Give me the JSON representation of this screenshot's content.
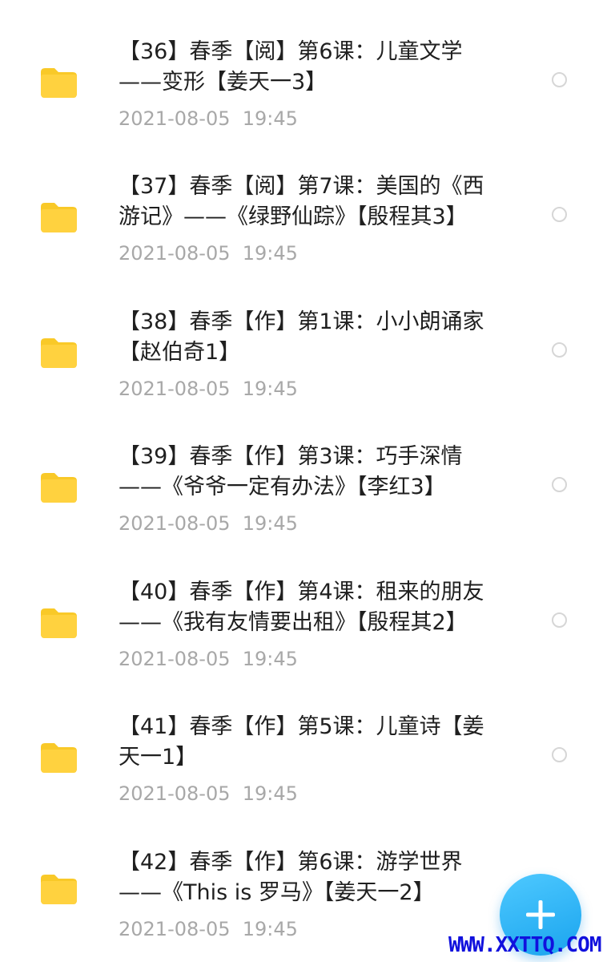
{
  "file_list": {
    "items": [
      {
        "title": "【36】春季【阅】第6课：儿童文学\n——变形【姜天一3】",
        "date": "2021-08-05  19:45",
        "icon": "folder-icon"
      },
      {
        "title": "【37】春季【阅】第7课：美国的《西\n游记》——《绿野仙踪》【殷程其3】",
        "date": "2021-08-05  19:45",
        "icon": "folder-icon"
      },
      {
        "title": "【38】春季【作】第1课：小小朗诵家\n【赵伯奇1】",
        "date": "2021-08-05  19:45",
        "icon": "folder-icon"
      },
      {
        "title": "【39】春季【作】第3课：巧手深情\n——《爷爷一定有办法》【李红3】",
        "date": "2021-08-05  19:45",
        "icon": "folder-icon"
      },
      {
        "title": "【40】春季【作】第4课：租来的朋友\n——《我有友情要出租》【殷程其2】",
        "date": "2021-08-05  19:45",
        "icon": "folder-icon"
      },
      {
        "title": "【41】春季【作】第5课：儿童诗【姜\n天一1】",
        "date": "2021-08-05  19:45",
        "icon": "folder-icon"
      },
      {
        "title": "【42】春季【作】第6课：游学世界\n——《This is 罗马》【姜天一2】",
        "date": "2021-08-05  19:45",
        "icon": "folder-icon"
      }
    ]
  },
  "fab": {
    "icon": "plus-icon"
  },
  "watermark": {
    "text": "WWW.XXTTQ.COM"
  },
  "colors": {
    "folder": "#ffd23f",
    "folder_tab": "#f9c928",
    "title_text": "#1f1f1f",
    "date_text": "#a8a8a8",
    "fab": "#26b0f5",
    "watermark": "#1111dd"
  }
}
